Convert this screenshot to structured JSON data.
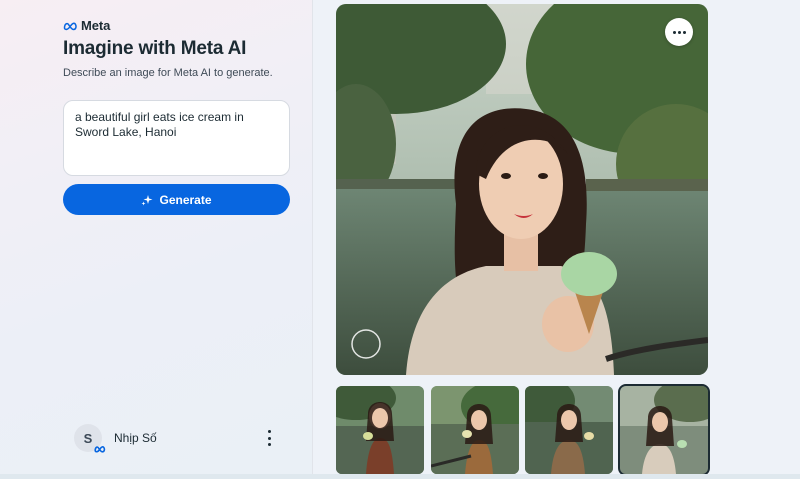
{
  "brand": {
    "logo_text": "Meta"
  },
  "header": {
    "title": "Imagine with Meta AI",
    "subtitle": "Describe an image for Meta AI to generate."
  },
  "prompt": {
    "value": "a beautiful girl eats ice cream in Sword Lake, Hanoi"
  },
  "generate_button": {
    "label": "Generate"
  },
  "user": {
    "initial": "S",
    "name": "Nhịp Số"
  },
  "colors": {
    "accent": "#0866e0",
    "text": "#1c2b33",
    "panel_bg": "#f1eff6"
  },
  "icons": {
    "logo": "meta-infinity-icon",
    "generate": "sparkle-icon",
    "more": "more-horizontal-icon",
    "user_menu": "more-vertical-icon",
    "badge": "meta-infinity-icon"
  },
  "gallery": {
    "main_image": "generated-image-girl-eating-ice-cream-by-lake",
    "thumbnails": [
      {
        "name": "thumbnail-1",
        "selected": false
      },
      {
        "name": "thumbnail-2",
        "selected": false
      },
      {
        "name": "thumbnail-3",
        "selected": false
      },
      {
        "name": "thumbnail-4",
        "selected": true
      }
    ]
  }
}
